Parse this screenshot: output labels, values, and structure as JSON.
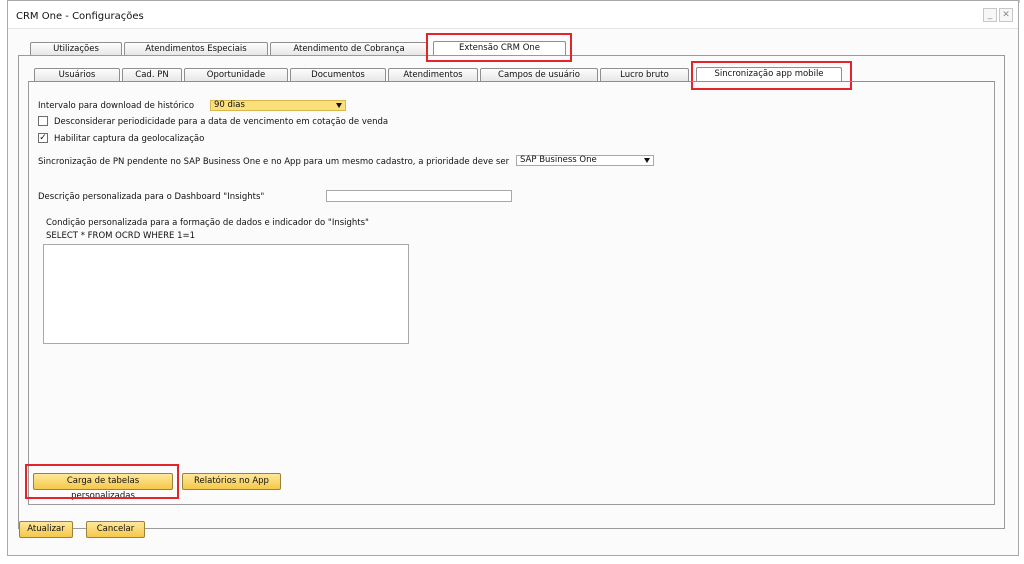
{
  "window": {
    "title": "CRM One - Configurações",
    "minimize_glyph": "_",
    "close_glyph": "✕"
  },
  "main_tabs": [
    {
      "label": "Utilizações",
      "active": false
    },
    {
      "label": "Atendimentos Especiais",
      "active": false
    },
    {
      "label": "Atendimento de Cobrança",
      "active": false
    },
    {
      "label": "Extensão CRM One",
      "active": true
    }
  ],
  "sub_tabs": [
    {
      "label": "Usuários",
      "active": false
    },
    {
      "label": "Cad. PN",
      "active": false
    },
    {
      "label": "Oportunidade",
      "active": false
    },
    {
      "label": "Documentos",
      "active": false
    },
    {
      "label": "Atendimentos",
      "active": false
    },
    {
      "label": "Campos de usuário",
      "active": false
    },
    {
      "label": "Lucro bruto",
      "active": false
    },
    {
      "label": "Sincronização app mobile",
      "active": true
    }
  ],
  "form": {
    "history_interval": {
      "label": "Intervalo para download de histórico",
      "value": "90 dias"
    },
    "ignore_periodicity": {
      "label": "Desconsiderar periodicidade para a data de vencimento em cotação de venda",
      "checked": false
    },
    "geolocation": {
      "label": "Habilitar captura da geolocalização",
      "checked": true,
      "check_glyph": "✓"
    },
    "sync_priority": {
      "label": "Sincronização de PN pendente no SAP Business One e no App para um mesmo cadastro, a prioridade deve ser",
      "value": "SAP Business One"
    },
    "insights_description": {
      "label": "Descrição personalizada para o Dashboard \"Insights\"",
      "value": ""
    },
    "insights_condition": {
      "label": "Condição personalizada para a formação de dados e indicador do \"Insights\"",
      "query": "SELECT * FROM OCRD WHERE 1=1",
      "value": ""
    }
  },
  "panel_buttons": {
    "load_tables": "Carga de tabelas personalizadas",
    "app_reports": "Relatórios no App"
  },
  "footer_buttons": {
    "update": "Atualizar",
    "cancel": "Cancelar"
  },
  "colors": {
    "highlight": "#e3242b",
    "button": "#f4c84b",
    "select_highlight": "#fbe07a"
  }
}
